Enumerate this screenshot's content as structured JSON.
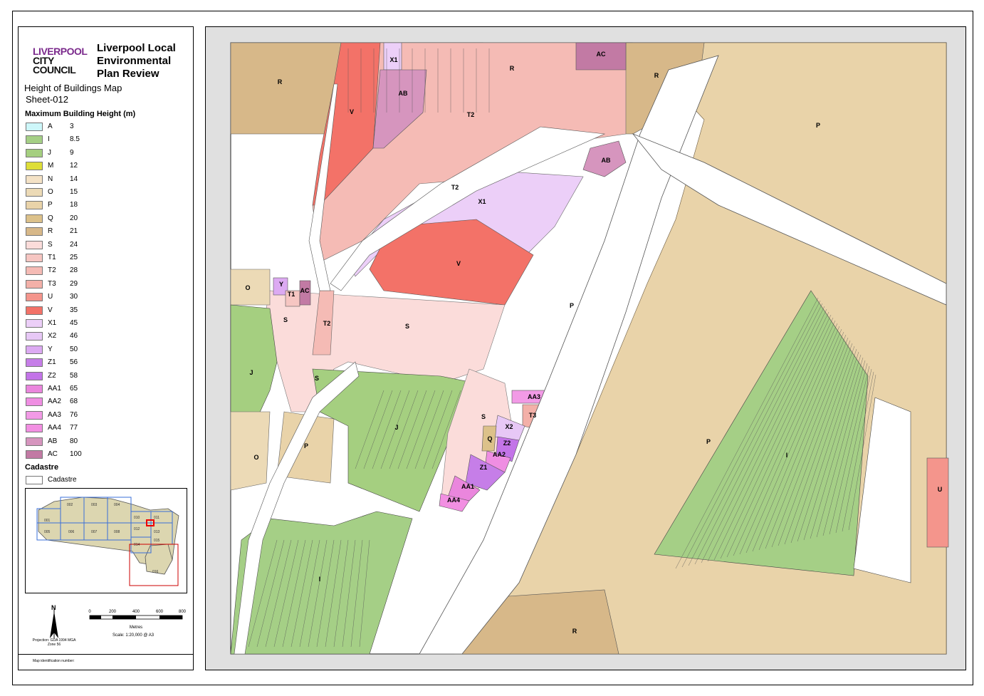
{
  "council": {
    "line1": "LIVERPOOL",
    "line2": "CITY",
    "line3": "COUNCIL"
  },
  "plan_title": "Liverpool Local Environmental Plan Review",
  "map_name": "Height of Buildings Map",
  "sheet_id": "Sheet-012",
  "legend_heading": "Maximum Building Height (m)",
  "legend": [
    {
      "code": "A",
      "value": "3",
      "color": "#cdf7fa"
    },
    {
      "code": "I",
      "value": "8.5",
      "color": "#a5cf86"
    },
    {
      "code": "J",
      "value": "9",
      "color": "#a5cf80"
    },
    {
      "code": "M",
      "value": "12",
      "color": "#dede38"
    },
    {
      "code": "N",
      "value": "14",
      "color": "#f4e2c6"
    },
    {
      "code": "O",
      "value": "15",
      "color": "#ecdab6"
    },
    {
      "code": "P",
      "value": "18",
      "color": "#e9d3a9"
    },
    {
      "code": "Q",
      "value": "20",
      "color": "#dcc18a"
    },
    {
      "code": "R",
      "value": "21",
      "color": "#d7b889"
    },
    {
      "code": "S",
      "value": "24",
      "color": "#fbdcda"
    },
    {
      "code": "T1",
      "value": "25",
      "color": "#f6c6c2"
    },
    {
      "code": "T2",
      "value": "28",
      "color": "#f5bbb5"
    },
    {
      "code": "T3",
      "value": "29",
      "color": "#f3b0a8"
    },
    {
      "code": "U",
      "value": "30",
      "color": "#f4958c"
    },
    {
      "code": "V",
      "value": "35",
      "color": "#f37268"
    },
    {
      "code": "X1",
      "value": "45",
      "color": "#eccff8"
    },
    {
      "code": "X2",
      "value": "46",
      "color": "#e7c8f6"
    },
    {
      "code": "Y",
      "value": "50",
      "color": "#dcaaf2"
    },
    {
      "code": "Z1",
      "value": "56",
      "color": "#c67ee8"
    },
    {
      "code": "Z2",
      "value": "58",
      "color": "#c374e8"
    },
    {
      "code": "AA1",
      "value": "65",
      "color": "#ea86dd"
    },
    {
      "code": "AA2",
      "value": "68",
      "color": "#ef8ee2"
    },
    {
      "code": "AA3",
      "value": "76",
      "color": "#f29ae6"
    },
    {
      "code": "AA4",
      "value": "77",
      "color": "#f28fe2"
    },
    {
      "code": "AB",
      "value": "80",
      "color": "#d695be"
    },
    {
      "code": "AC",
      "value": "100",
      "color": "#c27aa4"
    }
  ],
  "cadastre_heading": "Cadastre",
  "cadastre_label": "Cadastre",
  "inset_sheets": [
    "001",
    "002",
    "003",
    "004",
    "005",
    "006",
    "007",
    "008",
    "010",
    "011",
    "012",
    "013",
    "014",
    "015",
    "016"
  ],
  "north_label": "N",
  "scale_ticks": [
    "0",
    "200",
    "400",
    "600",
    "800"
  ],
  "scale_unit": "Metres",
  "projection": "Projection: GDA 1994 MGA Zone 56",
  "scale_text": "Scale: 1:20,000 @ A3",
  "identification": "Map identification number:",
  "zone_labels": [
    "R",
    "V",
    "X1",
    "AB",
    "T2",
    "R",
    "AC",
    "R",
    "P",
    "AB",
    "T2",
    "X1",
    "V",
    "P",
    "O",
    "Y",
    "T1",
    "AC",
    "S",
    "T2",
    "S",
    "J",
    "S",
    "J",
    "P",
    "O",
    "AA3",
    "T3",
    "S",
    "X2",
    "Q",
    "Z2",
    "AA2",
    "Z1",
    "AA1",
    "AA4",
    "P",
    "I",
    "I",
    "U",
    "R"
  ]
}
